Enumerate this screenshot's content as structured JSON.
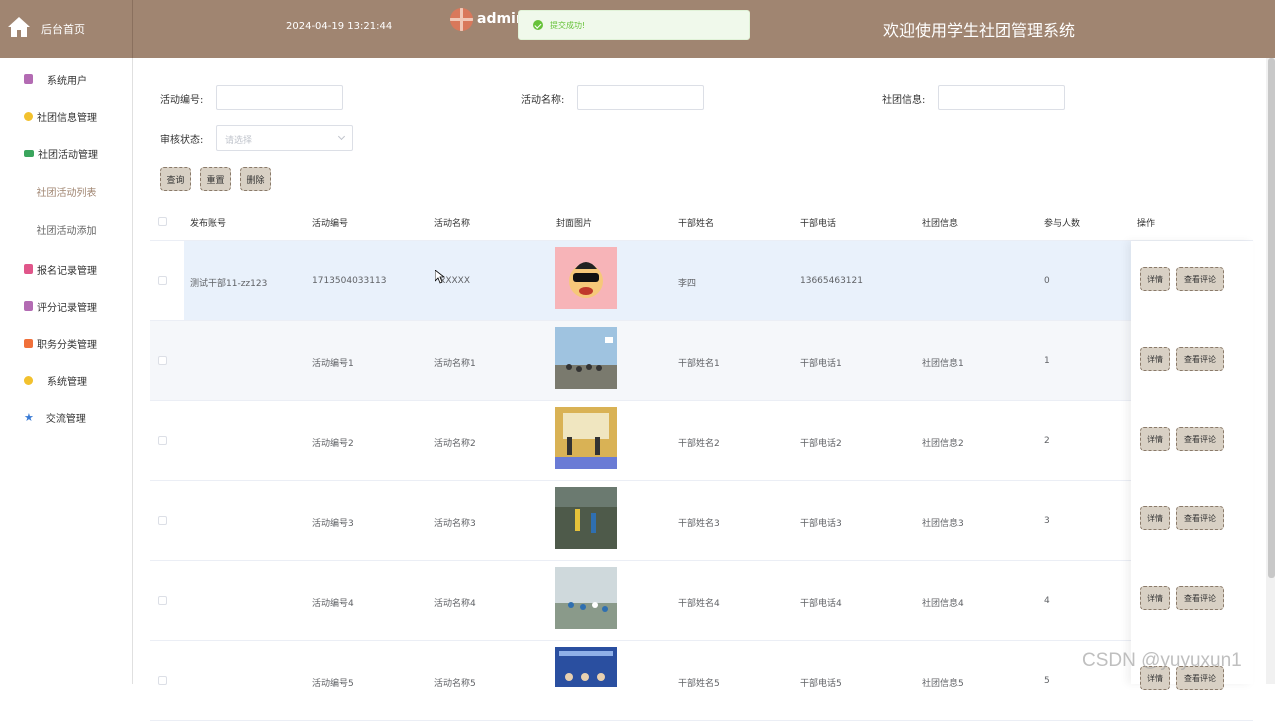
{
  "header": {
    "home_label": "后台首页",
    "datetime": "2024-04-19 13:21:44",
    "username": "admin",
    "site_title": "欢迎使用学生社团管理系统",
    "toast": "提交成功!"
  },
  "sidebar": {
    "items": [
      {
        "label": "系统用户",
        "icon": "user-icon",
        "color": "#b36bb3"
      },
      {
        "label": "社团信息管理",
        "icon": "cube-icon",
        "color": "#f2c12e"
      },
      {
        "label": "社团活动管理",
        "icon": "message-icon",
        "color": "#3aa55d"
      },
      {
        "label": "社团活动列表",
        "sub": true,
        "active": true
      },
      {
        "label": "社团活动添加",
        "sub": true
      },
      {
        "label": "报名记录管理",
        "icon": "doc-icon",
        "color": "#e0568a"
      },
      {
        "label": "评分记录管理",
        "icon": "list-icon",
        "color": "#b36bb3"
      },
      {
        "label": "职务分类管理",
        "icon": "grid-icon",
        "color": "#f0703a"
      },
      {
        "label": "系统管理",
        "icon": "cube-icon",
        "color": "#f2c12e"
      },
      {
        "label": "交流管理",
        "icon": "star-icon",
        "color": "#3a7bd5"
      }
    ]
  },
  "search": {
    "activity_no_label": "活动编号:",
    "activity_name_label": "活动名称:",
    "club_info_label": "社团信息:",
    "review_status_label": "审核状态:",
    "review_status_placeholder": "请选择",
    "query_btn": "查询",
    "reset_btn": "重置",
    "delete_btn": "删除"
  },
  "table": {
    "headers": [
      "发布账号",
      "活动编号",
      "活动名称",
      "封面图片",
      "干部姓名",
      "干部电话",
      "社团信息",
      "参与人数",
      "操作"
    ],
    "detail_btn": "详情",
    "comment_btn": "查看评论",
    "rows": [
      {
        "account": "测试干部11-zz123",
        "no": "1713504033113",
        "name": "xXXXX",
        "cadre": "李四",
        "phone": "13665463121",
        "club": "",
        "count": "0"
      },
      {
        "account": "",
        "no": "活动编号1",
        "name": "活动名称1",
        "cadre": "干部姓名1",
        "phone": "干部电话1",
        "club": "社团信息1",
        "count": "1"
      },
      {
        "account": "",
        "no": "活动编号2",
        "name": "活动名称2",
        "cadre": "干部姓名2",
        "phone": "干部电话2",
        "club": "社团信息2",
        "count": "2"
      },
      {
        "account": "",
        "no": "活动编号3",
        "name": "活动名称3",
        "cadre": "干部姓名3",
        "phone": "干部电话3",
        "club": "社团信息3",
        "count": "3"
      },
      {
        "account": "",
        "no": "活动编号4",
        "name": "活动名称4",
        "cadre": "干部姓名4",
        "phone": "干部电话4",
        "club": "社团信息4",
        "count": "4"
      },
      {
        "account": "",
        "no": "活动编号5",
        "name": "活动名称5",
        "cadre": "干部姓名5",
        "phone": "干部电话5",
        "club": "社团信息5",
        "count": "5"
      }
    ]
  },
  "watermark": "CSDN @yuyuxun1",
  "colors": {
    "header": "#a08571",
    "button": "#d8d0c4",
    "success": "#67c23a"
  }
}
